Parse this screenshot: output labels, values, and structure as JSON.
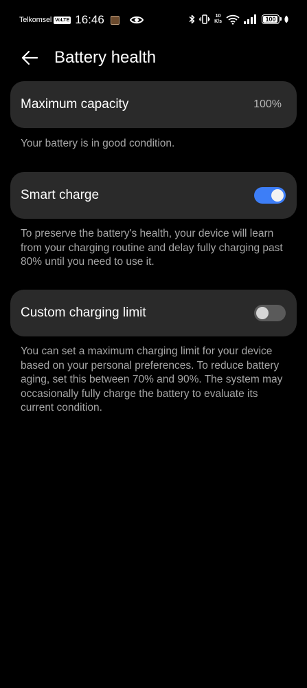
{
  "status_bar": {
    "carrier": "Telkomsel",
    "volte": "VoLTE",
    "time": "16:46",
    "net_speed_value": "10",
    "net_speed_unit": "K/s",
    "battery_level": "100",
    "battery_percent": 100,
    "icons": [
      "app-notification-icon",
      "eye-icon",
      "bluetooth-icon",
      "vibrate-icon",
      "wifi-icon",
      "signal-icon",
      "battery-icon",
      "leaf-charge-icon"
    ]
  },
  "header": {
    "title": "Battery health"
  },
  "max_capacity": {
    "label": "Maximum capacity",
    "value": "100%",
    "description": "Your battery is in good condition."
  },
  "smart_charge": {
    "label": "Smart charge",
    "enabled": true,
    "description": "To preserve the battery's health, your device will learn from your charging routine and delay fully charging past 80% until you need to use it."
  },
  "custom_limit": {
    "label": "Custom charging limit",
    "enabled": false,
    "description": "You can set a maximum charging limit for your device based on your personal preferences. To reduce battery aging, set this between 70% and 90%. The system may occasionally fully charge the battery to evaluate its current condition."
  },
  "colors": {
    "background": "#000000",
    "card": "#2a2a2a",
    "accent": "#3d7ef7",
    "toggle_off": "#5a5a5a",
    "secondary_text": "#a6a6a6"
  }
}
